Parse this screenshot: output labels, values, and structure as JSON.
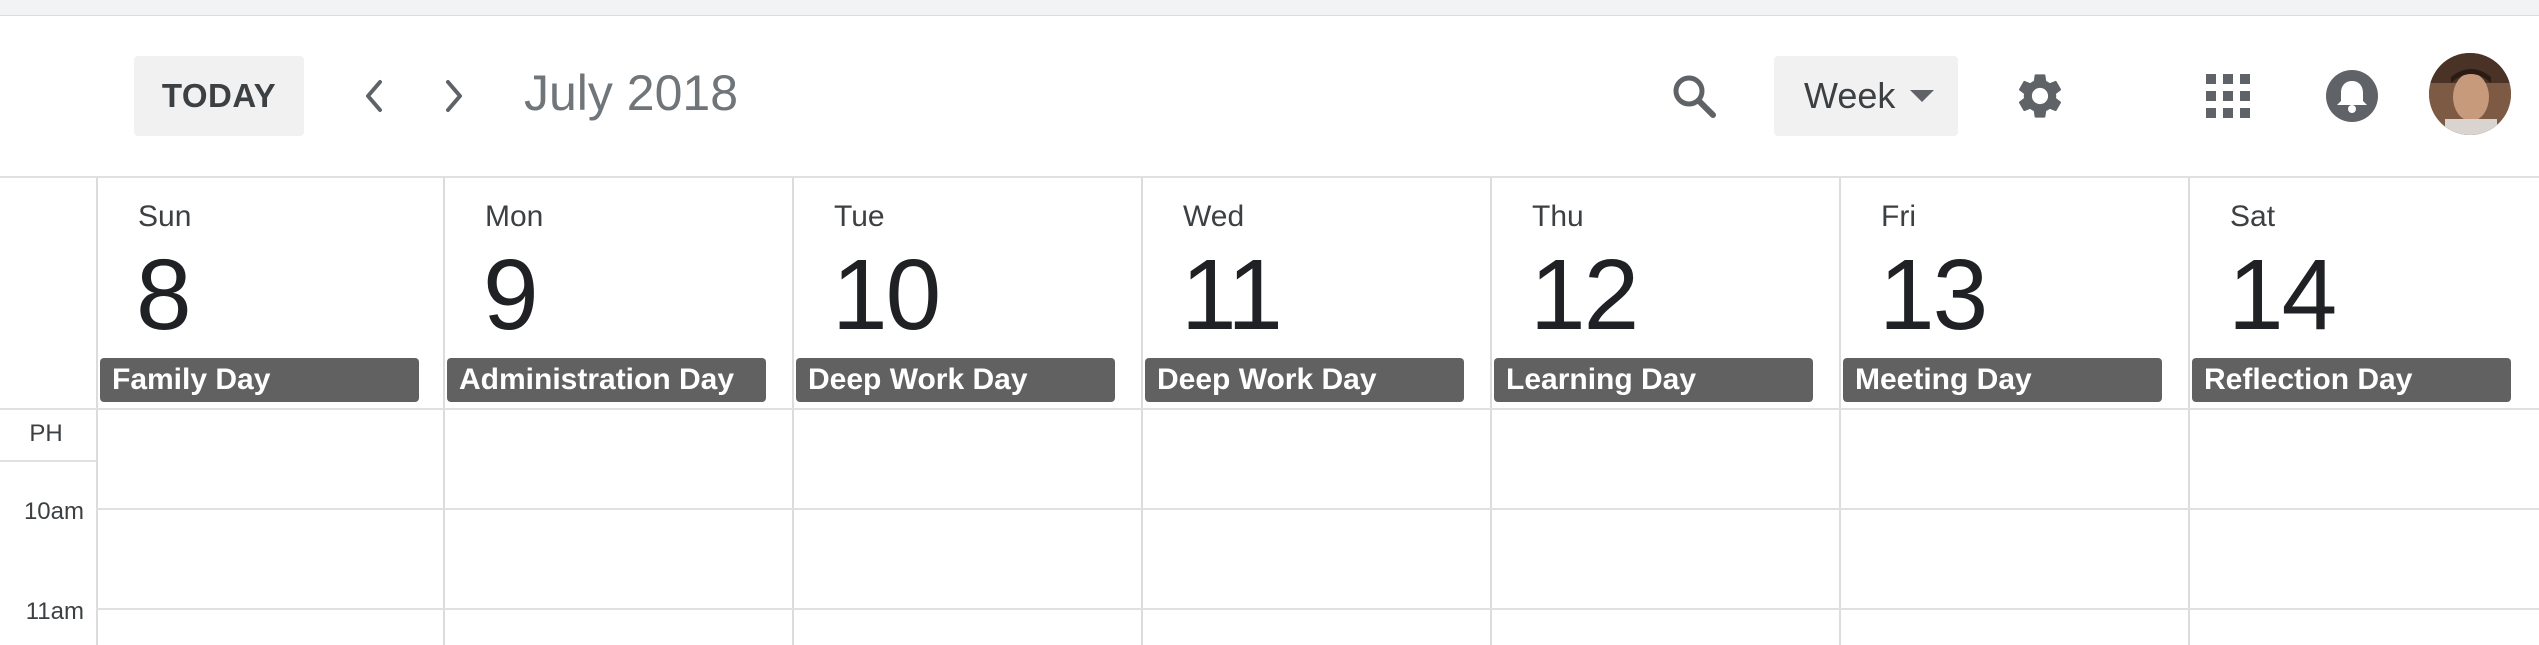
{
  "toolbar": {
    "today_label": "TODAY",
    "prev_icon": "chevron-left-icon",
    "next_icon": "chevron-right-icon",
    "month_title": "July 2018",
    "search_icon": "search-icon",
    "view_label": "Week",
    "view_dropdown_icon": "caret-down-icon",
    "settings_icon": "gear-icon",
    "apps_icon": "apps-grid-icon",
    "notifications_icon": "bell-icon",
    "avatar": "user-avatar"
  },
  "days": [
    {
      "name": "Sun",
      "number": "8",
      "allday": "Family Day"
    },
    {
      "name": "Mon",
      "number": "9",
      "allday": "Administration Day"
    },
    {
      "name": "Tue",
      "number": "10",
      "allday": "Deep Work Day"
    },
    {
      "name": "Wed",
      "number": "11",
      "allday": "Deep Work Day"
    },
    {
      "name": "Thu",
      "number": "12",
      "allday": "Learning Day"
    },
    {
      "name": "Fri",
      "number": "13",
      "allday": "Meeting Day"
    },
    {
      "name": "Sat",
      "number": "14",
      "allday": "Reflection Day"
    }
  ],
  "timezone": "PH",
  "times": [
    "10am",
    "11am"
  ],
  "colors": {
    "allday_chip": "#616161",
    "grid_line": "#e0e0e0",
    "button_bg": "#f1f1f1"
  }
}
